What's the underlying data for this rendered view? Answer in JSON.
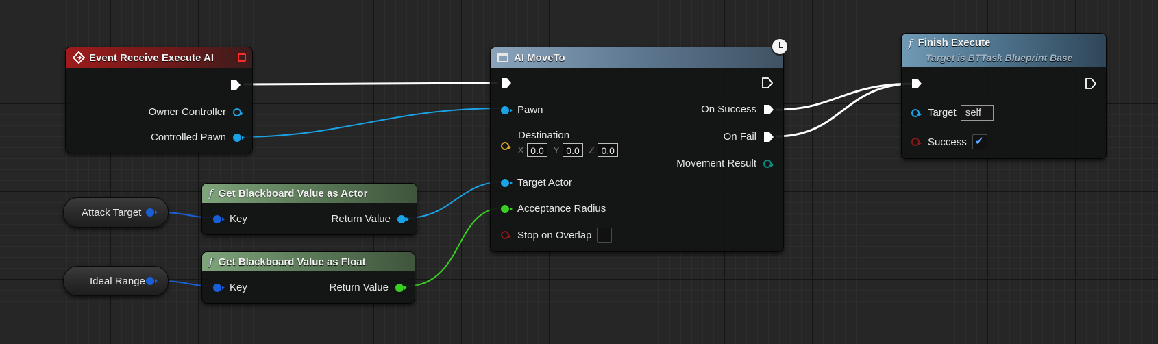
{
  "event_node": {
    "title": "Event Receive Execute AI",
    "pins": {
      "owner_controller": "Owner Controller",
      "controlled_pawn": "Controlled Pawn"
    }
  },
  "bb_actor_node": {
    "title": "Get Blackboard Value as Actor",
    "key": "Key",
    "return_value": "Return Value"
  },
  "bb_float_node": {
    "title": "Get Blackboard Value as Float",
    "key": "Key",
    "return_value": "Return Value"
  },
  "attack_target_var": {
    "label": "Attack Target"
  },
  "ideal_range_var": {
    "label": "Ideal Range"
  },
  "moveto_node": {
    "title": "AI MoveTo",
    "pins": {
      "pawn": "Pawn",
      "destination": "Destination",
      "target_actor": "Target Actor",
      "acceptance_radius": "Acceptance Radius",
      "stop_on_overlap": "Stop on Overlap",
      "on_success": "On Success",
      "on_fail": "On Fail",
      "movement_result": "Movement Result"
    },
    "destination": {
      "x_label": "X",
      "x": "0.0",
      "y_label": "Y",
      "y": "0.0",
      "z_label": "Z",
      "z": "0.0"
    },
    "stop_on_overlap_checked": false
  },
  "finish_node": {
    "title": "Finish Execute",
    "subtitle": "Target is BTTask Blueprint Base",
    "target_label": "Target",
    "target_value": "self",
    "success_label": "Success",
    "success_checked": true
  },
  "colors": {
    "exec_wire": "#ffffff",
    "object_wire": "#1aa3e6",
    "float_wire": "#3ad023",
    "key_wire": "#1a5fd6"
  }
}
